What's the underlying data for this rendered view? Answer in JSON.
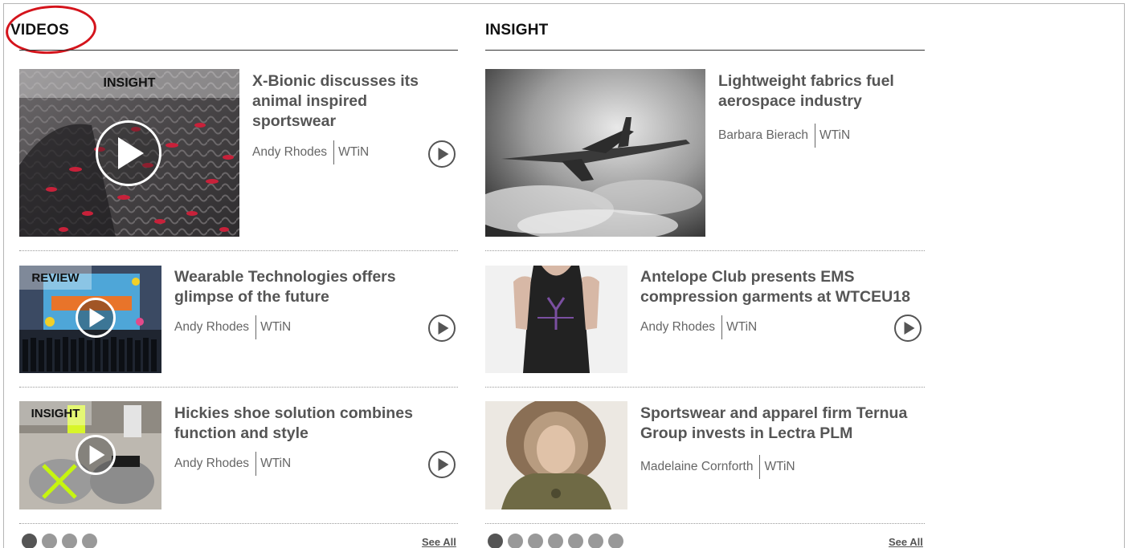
{
  "videos": {
    "title": "VIDEOS",
    "items": [
      {
        "tag": "INSIGHT",
        "headline": "X-Bionic discusses its animal inspired sportswear",
        "author": "Andy Rhodes",
        "source": "WTiN"
      },
      {
        "tag": "REVIEW",
        "headline": "Wearable Technologies offers glimpse of the future",
        "author": "Andy Rhodes",
        "source": "WTiN"
      },
      {
        "tag": "INSIGHT",
        "headline": "Hickies shoe solution combines function and style",
        "author": "Andy Rhodes",
        "source": "WTiN"
      }
    ],
    "pager": {
      "count": 4,
      "active": 0
    },
    "see_all": "See All"
  },
  "insight": {
    "title": "INSIGHT",
    "items": [
      {
        "headline": "Lightweight fabrics fuel aerospace industry",
        "author": "Barbara Bierach",
        "source": "WTiN"
      },
      {
        "headline": "Antelope Club presents EMS compression garments at WTCEU18",
        "author": "Andy Rhodes",
        "source": "WTiN"
      },
      {
        "headline": "Sportswear and apparel firm Ternua Group invests in Lectra PLM",
        "author": "Madelaine Cornforth",
        "source": "WTiN"
      }
    ],
    "pager": {
      "count": 7,
      "active": 0
    },
    "see_all": "See All"
  },
  "colors": {
    "highlight_circle": "#d4141c",
    "text": "#555555",
    "heading": "#111111"
  },
  "icons": {
    "video_play": "play-circle-icon",
    "article_play": "play-circle-outline-icon"
  }
}
